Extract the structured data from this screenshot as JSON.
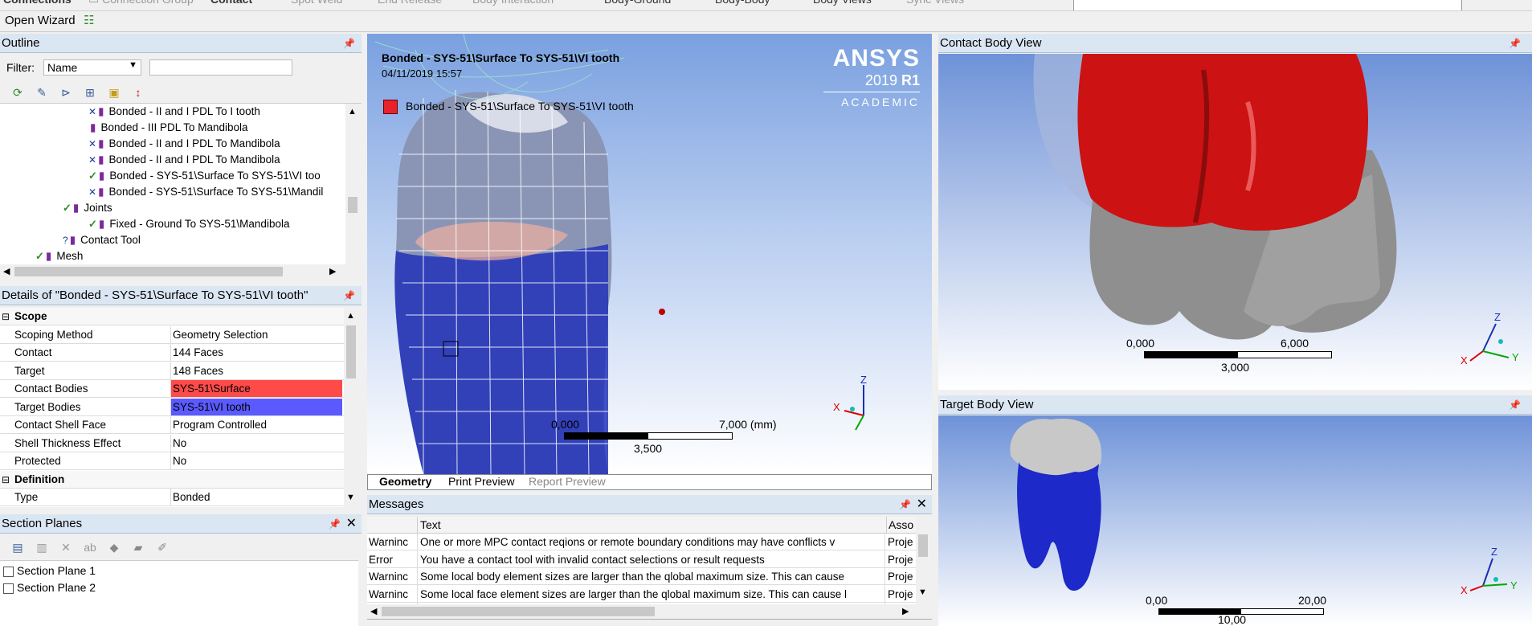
{
  "top_toolbar": {
    "items": [
      "Connections",
      "Connection Group",
      "Contact",
      "Spot Weld",
      "End Release",
      "Body Interaction",
      "Body-Ground",
      "Body-Body",
      "Body Views",
      "Sync Views"
    ],
    "wizard_label": "Open Wizard"
  },
  "outline": {
    "title": "Outline",
    "filter_label": "Filter:",
    "filter_value": "Name",
    "tree": [
      {
        "label": "Bonded - II and I PDL To I tooth",
        "state": "x"
      },
      {
        "label": "Bonded - III PDL To Mandibola",
        "state": "none"
      },
      {
        "label": "Bonded - II and I PDL To Mandibola",
        "state": "x"
      },
      {
        "label": "Bonded - II and I PDL To Mandibola",
        "state": "x"
      },
      {
        "label": "Bonded - SYS-51\\Surface To SYS-51\\VI too",
        "state": "check"
      },
      {
        "label": "Bonded - SYS-51\\Surface To SYS-51\\Mandil",
        "state": "x"
      },
      {
        "label": "Joints",
        "state": "check"
      },
      {
        "label": "Fixed - Ground To SYS-51\\Mandibola",
        "state": "check"
      },
      {
        "label": "Contact Tool",
        "state": "q"
      },
      {
        "label": "Mesh",
        "state": "check"
      }
    ]
  },
  "details": {
    "title": "Details of \"Bonded - SYS-51\\Surface To SYS-51\\VI tooth\"",
    "rows": [
      {
        "key": "Scope",
        "value": "",
        "section": true
      },
      {
        "key": "Scoping Method",
        "value": "Geometry Selection"
      },
      {
        "key": "Contact",
        "value": "144 Faces"
      },
      {
        "key": "Target",
        "value": "148 Faces"
      },
      {
        "key": "Contact Bodies",
        "value": "SYS-51\\Surface",
        "color": "#ff4a4a"
      },
      {
        "key": "Target Bodies",
        "value": "SYS-51\\VI tooth",
        "color": "#5a5aff"
      },
      {
        "key": "Contact Shell Face",
        "value": "Program Controlled"
      },
      {
        "key": "Shell Thickness Effect",
        "value": "No"
      },
      {
        "key": "Protected",
        "value": "No"
      },
      {
        "key": "Definition",
        "value": "",
        "section": true
      },
      {
        "key": "Type",
        "value": "Bonded"
      }
    ]
  },
  "section_planes": {
    "title": "Section Planes",
    "items": [
      "Section Plane 1",
      "Section Plane 2"
    ]
  },
  "geometry": {
    "header_title": "Bonded - SYS-51\\Surface To SYS-51\\VI tooth",
    "timestamp": "04/11/2019 15:57",
    "legend_label": "Bonded - SYS-51\\Surface To SYS-51\\VI tooth",
    "legend_color": "#e8222a",
    "brand": "ANSYS",
    "version_num": "2019",
    "version_r": "R1",
    "edition": "ACADEMIC",
    "scale_left": "0,000",
    "scale_right": "7,000 (mm)",
    "scale_mid": "3,500",
    "tabs": [
      "Geometry",
      "Print Preview",
      "Report Preview"
    ]
  },
  "messages": {
    "title": "Messages",
    "headers": [
      "",
      "Text",
      "Asso"
    ],
    "rows": [
      {
        "type": "Warninc",
        "text": "One or more MPC contact reqions or remote boundary conditions may have conflicts v",
        "assoc": "Proje"
      },
      {
        "type": "Error",
        "text": "You have a contact tool with invalid contact selections or result requests",
        "assoc": "Proje"
      },
      {
        "type": "Warninc",
        "text": "Some local body element sizes are larger than the qlobal maximum size. This can cause",
        "assoc": "Proje"
      },
      {
        "type": "Warninc",
        "text": "Some local face element sizes are larger than the qlobal maximum size. This can cause l",
        "assoc": "Proje"
      }
    ]
  },
  "contact_view": {
    "title": "Contact Body View",
    "scale_left": "0,000",
    "scale_right": "6,000",
    "scale_mid": "3,000"
  },
  "target_view": {
    "title": "Target Body View",
    "scale_left": "0,00",
    "scale_right": "20,00",
    "scale_mid": "10,00"
  },
  "axes": {
    "x": "X",
    "y": "Y",
    "z": "Z"
  }
}
